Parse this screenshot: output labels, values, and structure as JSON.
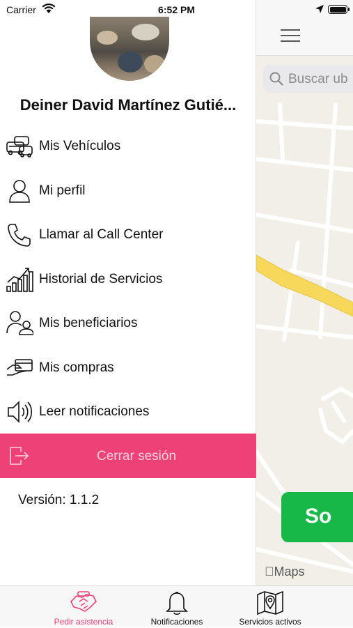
{
  "status_bar": {
    "carrier": "Carrier",
    "time": "6:52 PM"
  },
  "drawer": {
    "user_name": "Deiner David Martínez Gutié...",
    "menu": [
      {
        "label": "Mis Vehículos",
        "icon": "cars-icon"
      },
      {
        "label": "Mi perfil",
        "icon": "user-icon"
      },
      {
        "label": "Llamar al Call Center",
        "icon": "phone-icon"
      },
      {
        "label": "Historial de Servicios",
        "icon": "chart-icon"
      },
      {
        "label": "Mis beneficiarios",
        "icon": "beneficiaries-icon"
      },
      {
        "label": "Mis compras",
        "icon": "card-icon"
      },
      {
        "label": "Leer notificaciones",
        "icon": "speaker-icon"
      }
    ],
    "logout_label": "Cerrar sesión",
    "version": "Versión: 1.1.2"
  },
  "map": {
    "search_placeholder": "Buscar ub",
    "request_button_label": "So",
    "maps_attribution": "Maps"
  },
  "tab_bar": {
    "tabs": [
      {
        "label": "Pedir asistencia",
        "icon": "handshake-icon",
        "active": true
      },
      {
        "label": "Notificaciones",
        "icon": "bell-icon",
        "active": false
      },
      {
        "label": "Servicios activos",
        "icon": "map-pin-icon",
        "active": false
      }
    ]
  },
  "colors": {
    "accent": "#ee4178",
    "map_button": "#18b848",
    "road_highlight": "#f7d85a"
  }
}
